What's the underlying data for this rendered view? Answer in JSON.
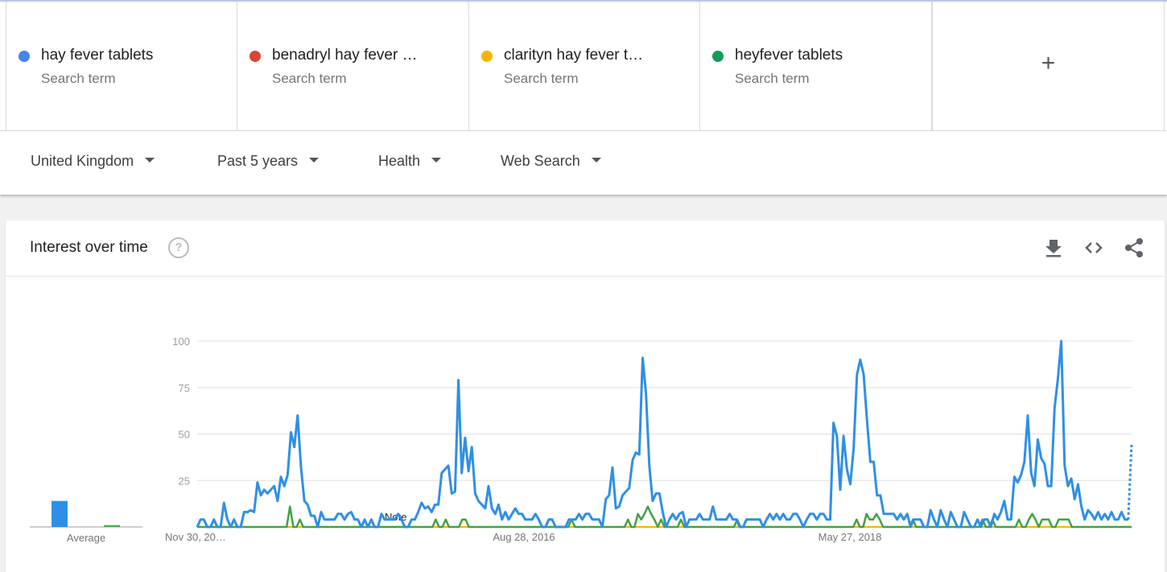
{
  "search_terms": [
    {
      "label": "hay fever tablets",
      "sub": "Search term",
      "color": "#4285f4"
    },
    {
      "label": "benadryl hay fever …",
      "sub": "Search term",
      "color": "#db4437"
    },
    {
      "label": "clarityn hay fever t…",
      "sub": "Search term",
      "color": "#f4b400"
    },
    {
      "label": "heyfever tablets",
      "sub": "Search term",
      "color": "#0f9d58"
    }
  ],
  "add_term": {
    "symbol": "+"
  },
  "filters": {
    "region": "United Kingdom",
    "time_range": "Past 5 years",
    "category": "Health",
    "search_type": "Web Search"
  },
  "panel": {
    "title": "Interest over time",
    "help_symbol": "?",
    "icons": [
      "download-icon",
      "embed-icon",
      "share-icon"
    ]
  },
  "chart_data": {
    "type": "line",
    "title": "",
    "ylim": [
      0,
      100
    ],
    "y_ticks": [
      "100",
      "75",
      "50",
      "25"
    ],
    "x_tick_labels": [
      "Nov 30, 20…",
      "Aug 28, 2016",
      "May 27, 2018"
    ],
    "note_label": "Note",
    "average_label": "Average",
    "averages": [
      {
        "value": 14,
        "color": "#2f8fe6"
      },
      {
        "value": 0,
        "color": "#db4437"
      },
      {
        "value": 0,
        "color": "#f4b400"
      },
      {
        "value": 1,
        "color": "#4caf50"
      }
    ],
    "series": [
      {
        "color": "#2f8fe6",
        "values": [
          0,
          4,
          4,
          0,
          0,
          4,
          0,
          0,
          13,
          4,
          0,
          4,
          0,
          0,
          8,
          8,
          9,
          8,
          24,
          17,
          20,
          18,
          20,
          22,
          14,
          27,
          22,
          28,
          51,
          43,
          60,
          32,
          14,
          12,
          6,
          6,
          0,
          8,
          4,
          4,
          4,
          4,
          7,
          7,
          4,
          7,
          8,
          4,
          4,
          0,
          4,
          0,
          4,
          0,
          0,
          7,
          4,
          4,
          4,
          4,
          7,
          4,
          0,
          0,
          4,
          4,
          8,
          13,
          10,
          11,
          8,
          12,
          12,
          29,
          31,
          33,
          18,
          19,
          79,
          29,
          48,
          30,
          43,
          18,
          14,
          12,
          10,
          22,
          10,
          7,
          12,
          4,
          8,
          4,
          7,
          10,
          7,
          7,
          4,
          4,
          4,
          7,
          4,
          0,
          0,
          4,
          4,
          0,
          0,
          0,
          0,
          4,
          4,
          4,
          7,
          4,
          7,
          7,
          4,
          4,
          4,
          0,
          15,
          17,
          32,
          10,
          11,
          17,
          19,
          21,
          36,
          40,
          39,
          91,
          72,
          33,
          14,
          18,
          18,
          8,
          0,
          4,
          7,
          4,
          7,
          8,
          0,
          4,
          4,
          4,
          7,
          4,
          4,
          4,
          11,
          4,
          4,
          4,
          4,
          7,
          4,
          4,
          0,
          0,
          4,
          4,
          4,
          4,
          4,
          0,
          4,
          7,
          4,
          7,
          4,
          7,
          4,
          4,
          7,
          7,
          4,
          0,
          4,
          7,
          7,
          4,
          7,
          7,
          4,
          4,
          56,
          49,
          20,
          49,
          31,
          23,
          42,
          82,
          90,
          82,
          57,
          35,
          35,
          17,
          17,
          7,
          7,
          7,
          7,
          4,
          7,
          4,
          7,
          0,
          4,
          4,
          4,
          0,
          0,
          9,
          4,
          0,
          9,
          4,
          0,
          8,
          4,
          0,
          0,
          8,
          4,
          0,
          0,
          4,
          0,
          4,
          4,
          0,
          7,
          4,
          8,
          14,
          4,
          4,
          27,
          24,
          28,
          35,
          60,
          29,
          22,
          47,
          37,
          34,
          22,
          22,
          64,
          80,
          100,
          33,
          22,
          26,
          15,
          23,
          11,
          4,
          9,
          7,
          4,
          8,
          4,
          7,
          4,
          8,
          4,
          4,
          8,
          4,
          4,
          45
        ]
      },
      {
        "color": "#db4437",
        "values": [
          0,
          0
        ]
      },
      {
        "color": "#f4b400",
        "values": [
          0,
          0
        ]
      },
      {
        "color": "#43a047",
        "values": [
          0,
          0,
          0,
          0,
          0,
          0,
          0,
          0,
          0,
          0,
          0,
          0,
          0,
          0,
          0,
          0,
          0,
          0,
          0,
          0,
          0,
          0,
          0,
          0,
          0,
          0,
          0,
          0,
          11,
          0,
          0,
          4,
          0,
          0,
          0,
          0,
          0,
          0,
          0,
          0,
          0,
          0,
          0,
          0,
          0,
          0,
          0,
          0,
          0,
          0,
          0,
          0,
          0,
          0,
          0,
          0,
          0,
          0,
          0,
          0,
          0,
          0,
          0,
          0,
          0,
          0,
          0,
          0,
          0,
          0,
          0,
          0,
          4,
          0,
          0,
          4,
          0,
          0,
          0,
          0,
          4,
          4,
          0,
          0,
          0,
          0,
          0,
          0,
          0,
          0,
          0,
          0,
          0,
          0,
          0,
          0,
          0,
          0,
          0,
          0,
          0,
          0,
          0,
          0,
          0,
          0,
          0,
          0,
          0,
          0,
          0,
          0,
          0,
          4,
          0,
          0,
          0,
          0,
          0,
          0,
          0,
          0,
          0,
          0,
          0,
          0,
          0,
          0,
          0,
          0,
          4,
          0,
          0,
          7,
          4,
          7,
          11,
          7,
          4,
          0,
          4,
          0,
          0,
          0,
          0,
          0,
          4,
          0,
          0,
          0,
          0,
          0,
          0,
          0,
          0,
          0,
          0,
          0,
          0,
          0,
          0,
          0,
          0,
          4,
          0,
          0,
          0,
          0,
          0,
          0,
          0,
          0,
          0,
          0,
          0,
          0,
          0,
          0,
          0,
          0,
          0,
          0,
          0,
          0,
          0,
          0,
          0,
          0,
          0,
          0,
          0,
          0,
          0,
          0,
          0,
          0,
          0,
          0,
          0,
          4,
          0,
          0,
          7,
          4,
          4,
          7,
          4,
          0,
          0,
          0,
          0,
          0,
          0,
          0,
          0,
          0,
          4,
          0,
          0,
          0,
          0,
          0,
          0,
          0,
          0,
          0,
          0,
          0,
          0,
          0,
          0,
          0,
          0,
          0,
          0,
          0,
          0,
          4,
          0,
          0,
          4,
          0,
          0,
          0,
          0,
          0,
          0,
          0,
          4,
          0,
          0,
          4,
          7,
          4,
          0,
          4,
          4,
          4,
          0,
          0,
          4,
          4,
          4,
          4,
          0,
          0,
          0,
          0,
          0,
          0,
          0,
          0,
          0,
          0,
          0,
          0,
          0,
          0,
          0,
          0,
          0,
          0,
          0
        ]
      }
    ]
  }
}
